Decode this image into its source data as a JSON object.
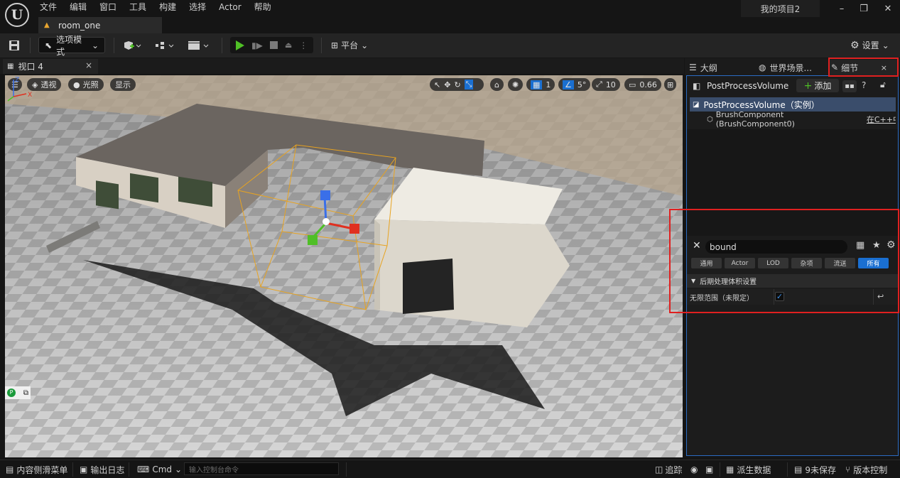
{
  "titlebar": {
    "menu": [
      "文件",
      "编辑",
      "窗口",
      "工具",
      "构建",
      "选择",
      "Actor",
      "帮助"
    ],
    "document_tab": "room_one",
    "project_name": "我的项目2"
  },
  "toolbar": {
    "mode_label": "选项模式",
    "platform_label": "平台",
    "settings_label": "设置"
  },
  "viewport": {
    "tab_label": "视口 4",
    "perspective_label": "透视",
    "lighting_label": "光照",
    "show_label": "显示",
    "grid_value": "1",
    "angle_value": "5°",
    "scale_value": "10",
    "camera_speed": "0.66"
  },
  "right_tabs": {
    "outliner": "大纲",
    "world_settings": "世界场景...",
    "details": "细节"
  },
  "details": {
    "actor_name": "PostProcessVolume",
    "add_label": "添加",
    "tree": {
      "root": "PostProcessVolume（实例）",
      "child": "BrushComponent (BrushComponent0)",
      "child_link": "在C++中"
    },
    "search_value": "bound",
    "filters": [
      "通用",
      "Actor",
      "LOD",
      "杂项",
      "流送",
      "所有"
    ],
    "active_filter": "所有",
    "category": "后期处理体积设置",
    "property_label": "无限范围（未限定）",
    "property_checked": true
  },
  "statusbar": {
    "content_drawer": "内容侧滑菜单",
    "output_log": "输出日志",
    "cmd_label": "Cmd",
    "cmd_placeholder": "输入控制台命令",
    "trace_label": "追踪",
    "derived_data": "派生数据",
    "unsaved": "9未保存",
    "source_control": "版本控制"
  },
  "colors": {
    "accent_blue": "#1a6fd1",
    "highlight_red": "#e02020",
    "play_green": "#4fbf26"
  }
}
